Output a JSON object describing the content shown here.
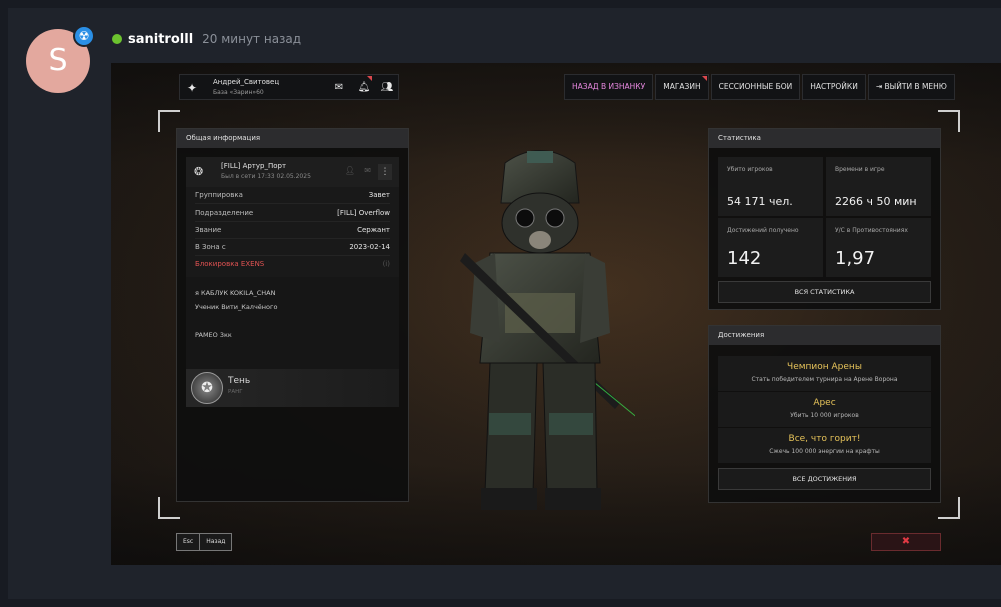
{
  "post": {
    "avatar_letter": "S",
    "avatar_color": "#e3a89e",
    "badge_icon": "radiation-icon",
    "username": "sanitrolll",
    "time_ago": "20 минут назад",
    "online_color": "#6cc32f"
  },
  "game": {
    "topbar": {
      "player_name": "Андрей_Свитовец",
      "player_base": "База «Зарин»60"
    },
    "nav": [
      {
        "label": "НАЗАД В ИЗНАНКУ",
        "active": true
      },
      {
        "label": "МАГАЗИН",
        "active": false
      },
      {
        "label": "СЕССИОННЫЕ БОИ",
        "active": false
      },
      {
        "label": "НАСТРОЙКИ",
        "active": false
      },
      {
        "label": "ВЫЙТИ В МЕНЮ",
        "active": false
      }
    ],
    "general": {
      "header": "Общая информация",
      "card_name": "[FILL] Артур_Порт",
      "card_seen": "Был в сети 17:33 02.05.2025",
      "rows": [
        {
          "label": "Группировка",
          "value": "Завет"
        },
        {
          "label": "Подразделение",
          "value": "[FILL] Overflow"
        },
        {
          "label": "Звание",
          "value": "Сержант"
        },
        {
          "label": "В Зона с",
          "value": "2023-02-14"
        }
      ],
      "ban_label": "Блокировка EXENS",
      "ban_value": "(i)",
      "about_lines": [
        "я КАБЛУК KOKILA_CHAN",
        "Ученик Вити_Калчёного",
        "PAMEO 3кк"
      ],
      "rank_name": "Тень",
      "rank_sub": "РАНГ"
    },
    "stats": {
      "header": "Статистика",
      "cells": [
        {
          "label": "Убито игроков",
          "value": "54 171 чел."
        },
        {
          "label": "Времени в игре",
          "value": "2266 ч 50 мин"
        },
        {
          "label": "Достижений получено",
          "value": "142"
        },
        {
          "label": "У/С в Противостояниях",
          "value": "1,97"
        }
      ],
      "all_button": "ВСЯ СТАТИСТИКА"
    },
    "achievements": {
      "header": "Достижения",
      "items": [
        {
          "title": "Чемпион Арены",
          "desc": "Стать победителем турнира на Арене Ворона"
        },
        {
          "title": "Арес",
          "desc": "Убить 10 000 игроков"
        },
        {
          "title": "Все, что горит!",
          "desc": "Сжечь 100 000 энергии на крафты"
        }
      ],
      "all_button": "ВСЕ ДОСТИЖЕНИЯ"
    },
    "keys": {
      "esc": "Esc",
      "back": "Назад"
    },
    "close_icon": "close-x-icon",
    "accent_nav": "#e889e0",
    "achievement_gold": "#e6c35a",
    "ban_red": "#e05252"
  }
}
